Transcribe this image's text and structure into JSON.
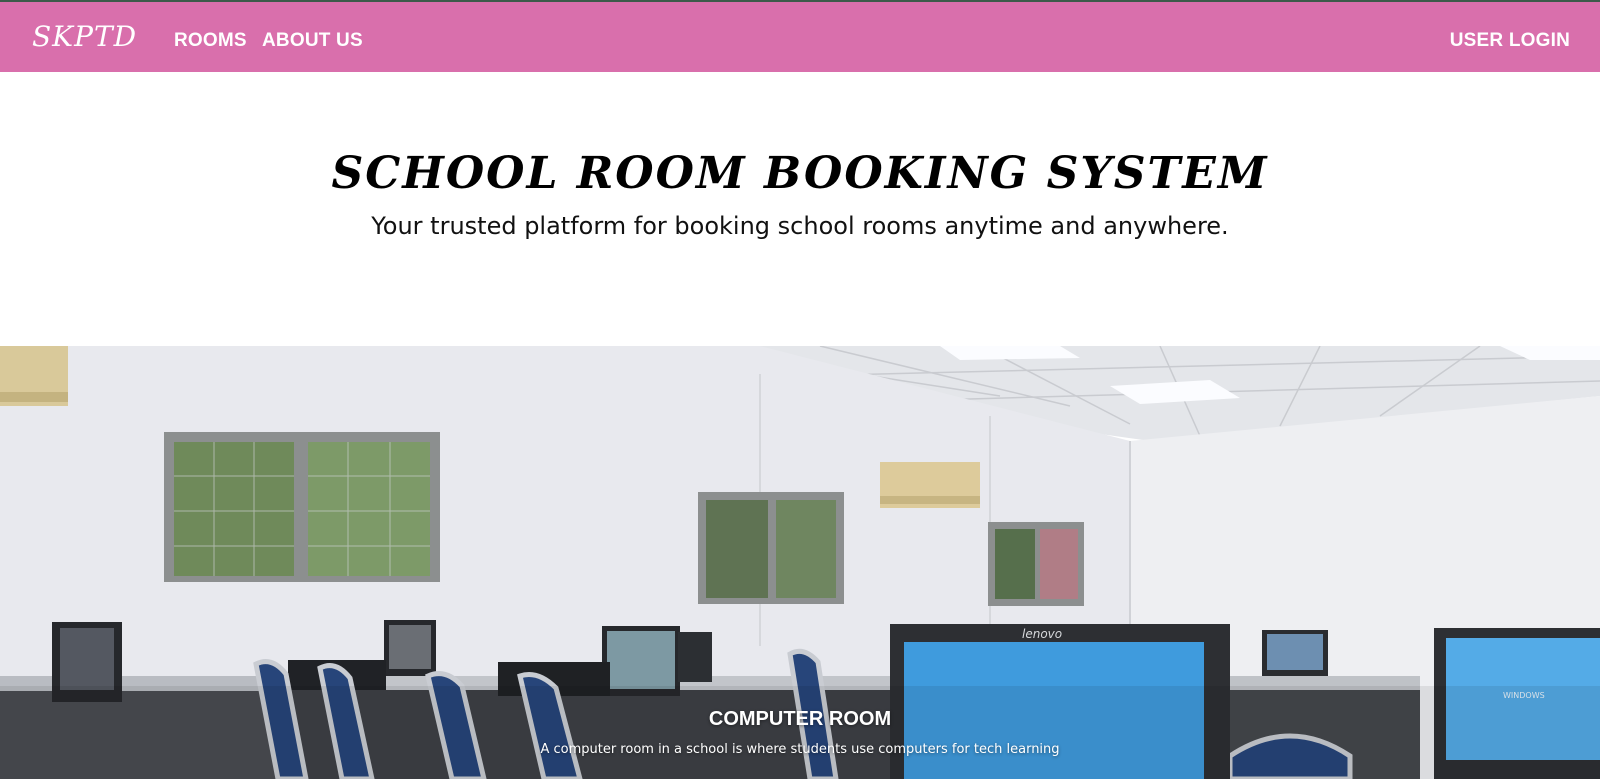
{
  "navbar": {
    "brand": "SKPTD",
    "links": [
      {
        "label": "ROOMS"
      },
      {
        "label": "ABOUT US"
      }
    ],
    "login_label": "USER LOGIN",
    "color": "#d96fac"
  },
  "hero": {
    "title": "SCHOOL ROOM BOOKING SYSTEM",
    "subtitle": "Your trusted platform for booking school rooms anytime and anywhere."
  },
  "carousel": {
    "slide": {
      "image": "computer-room-photo",
      "title": "COMPUTER ROOM",
      "description": "A computer room in a school is where students use computers for tech learning"
    }
  }
}
